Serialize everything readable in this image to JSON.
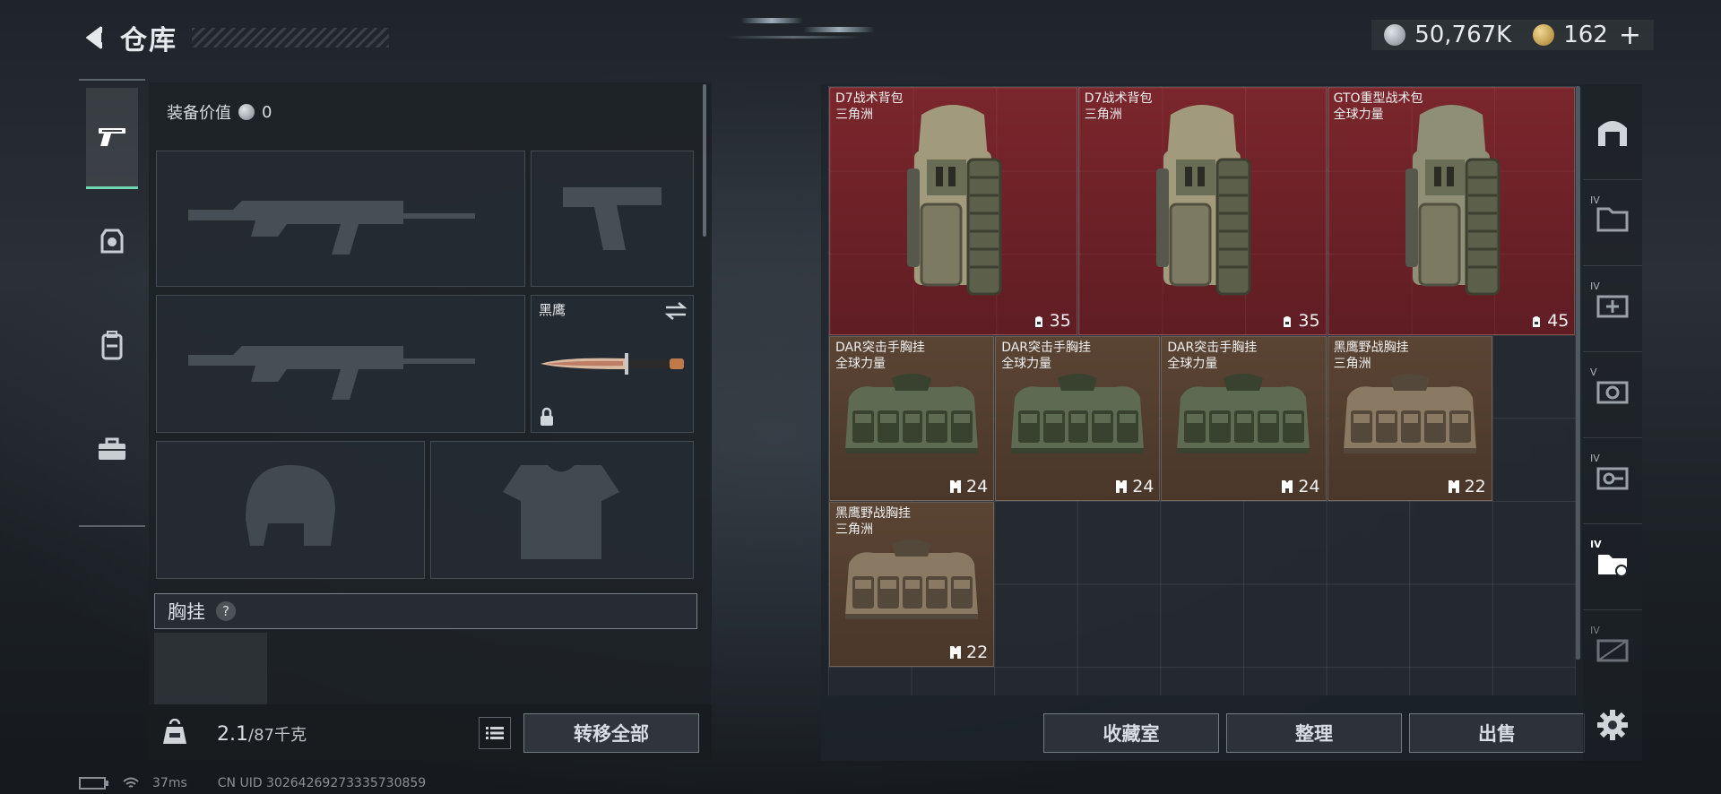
{
  "header": {
    "title": "仓库"
  },
  "currency": {
    "silver": "50,767K",
    "gold": "162",
    "plus": "+"
  },
  "loadout": {
    "equipment_value_label": "装备价值",
    "equipment_value": "0",
    "melee_slot_label": "黑鹰",
    "chest_rig_label": "胸挂",
    "help_label": "?"
  },
  "bottom_left": {
    "weight_value": "2.1",
    "weight_unit": "/87千克",
    "transfer_all": "转移全部"
  },
  "storage": {
    "items": [
      {
        "name": "D7战术背包",
        "sub": "三角洲",
        "count": "35",
        "rarity": "red"
      },
      {
        "name": "D7战术背包",
        "sub": "三角洲",
        "count": "35",
        "rarity": "red"
      },
      {
        "name": "GTO重型战术包",
        "sub": "全球力量",
        "count": "45",
        "rarity": "red"
      },
      {
        "name": "DAR突击手胸挂",
        "sub": "全球力量",
        "count": "24",
        "rarity": "brown"
      },
      {
        "name": "DAR突击手胸挂",
        "sub": "全球力量",
        "count": "24",
        "rarity": "brown"
      },
      {
        "name": "DAR突击手胸挂",
        "sub": "全球力量",
        "count": "24",
        "rarity": "brown"
      },
      {
        "name": "黑鹰野战胸挂",
        "sub": "三角洲",
        "count": "22",
        "rarity": "brown"
      },
      {
        "name": "黑鹰野战胸挂",
        "sub": "三角洲",
        "count": "22",
        "rarity": "brown"
      }
    ]
  },
  "actions": {
    "collection": "收藏室",
    "organize": "整理",
    "sell": "出售"
  },
  "right_sidebar": {
    "tier_label": "IV",
    "tier_label_5": "V"
  },
  "status": {
    "ping": "37ms",
    "uid": "CN UID 30264269273335730859"
  },
  "colors": {
    "accent": "#6ed6b0",
    "rare_red": "#7a262c",
    "uncommon_brown": "#5a4434"
  }
}
